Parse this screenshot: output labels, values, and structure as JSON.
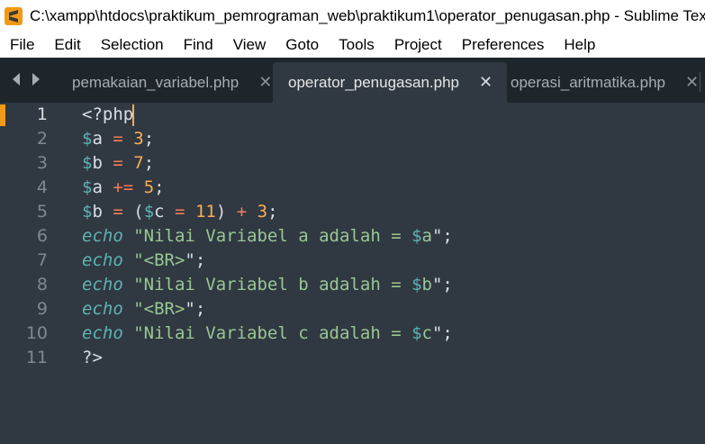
{
  "window": {
    "title": "C:\\xampp\\htdocs\\praktikum_pemrograman_web\\praktikum1\\operator_penugasan.php - Sublime Text"
  },
  "menu": [
    "File",
    "Edit",
    "Selection",
    "Find",
    "View",
    "Goto",
    "Tools",
    "Project",
    "Preferences",
    "Help"
  ],
  "tabs": [
    {
      "label": "pemakaian_variabel.php",
      "active": false
    },
    {
      "label": "operator_penugasan.php",
      "active": true
    },
    {
      "label": "operasi_aritmatika.php",
      "active": false
    }
  ],
  "editor": {
    "current_line": 1,
    "lines": [
      {
        "n": "1",
        "text": "<?php"
      },
      {
        "n": "2",
        "text": "$a = 3;"
      },
      {
        "n": "3",
        "text": "$b = 7;"
      },
      {
        "n": "4",
        "text": "$a += 5;"
      },
      {
        "n": "5",
        "text": "$b = ($c = 11) + 3;"
      },
      {
        "n": "6",
        "text": "echo \"Nilai Variabel a adalah = $a\";"
      },
      {
        "n": "7",
        "text": "echo \"<BR>\";"
      },
      {
        "n": "8",
        "text": "echo \"Nilai Variabel b adalah = $b\";"
      },
      {
        "n": "9",
        "text": "echo \"<BR>\";"
      },
      {
        "n": "10",
        "text": "echo \"Nilai Variabel c adalah = $c\";"
      },
      {
        "n": "11",
        "text": "?>"
      }
    ]
  },
  "colors": {
    "background": "#303841",
    "tabbar": "#1e252b",
    "variable": "#5fb3b3",
    "operator": "#f97b58",
    "number": "#f9ae58",
    "string": "#99c794",
    "accent": "#f09a18"
  }
}
